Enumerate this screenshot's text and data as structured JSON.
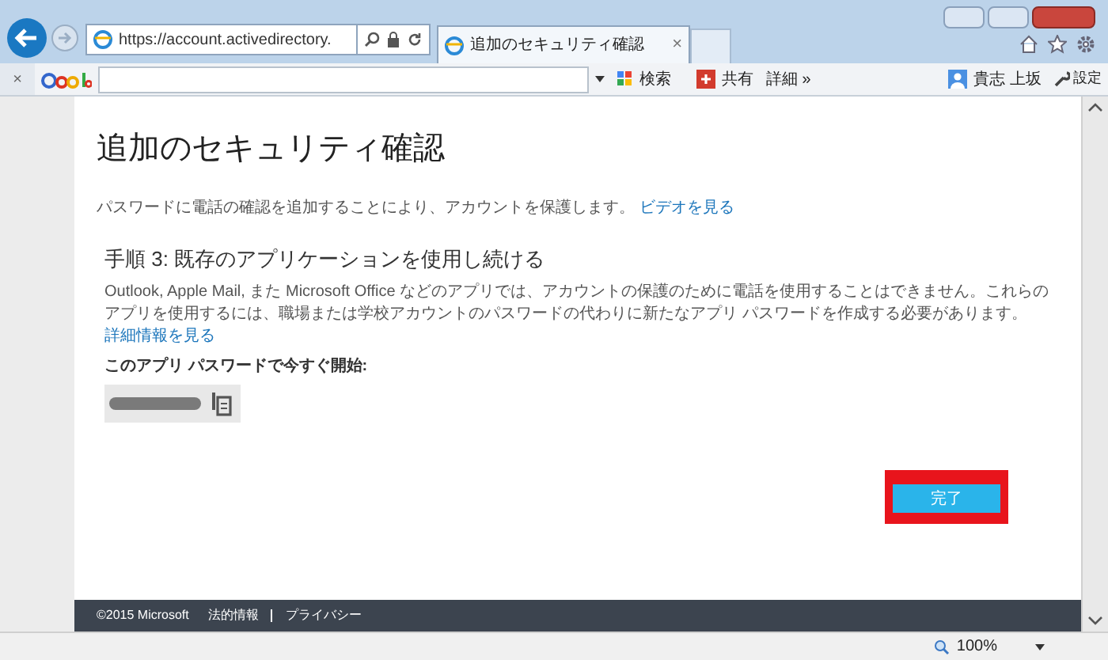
{
  "browser": {
    "address": "https://account.activedirectory.",
    "tab_title": "追加のセキュリティ確認",
    "toolbar": {
      "search_label": "検索",
      "share_label": "共有",
      "details_label": "詳細 »",
      "user_name": "貴志 上坂",
      "settings_label": "設定"
    },
    "close_mark": "×"
  },
  "page": {
    "title": "追加のセキュリティ確認",
    "intro": "パスワードに電話の確認を追加することにより、アカウントを保護します。",
    "intro_link": "ビデオを見る",
    "step_title": "手順 3: 既存のアプリケーションを使用し続ける",
    "step_text": "Outlook, Apple Mail, また Microsoft Office などのアプリでは、アカウントの保護のために電話を使用することはできません。これらのアプリを使用するには、職場または学校アカウントのパスワードの代わりに新たなアプリ パスワードを作成する必要があります。",
    "step_link": "詳細情報を見る",
    "password_label": "このアプリ パスワードで今すぐ開始:",
    "done_button": "完了",
    "done_highlighted": true
  },
  "footer": {
    "copyright": "©2015 Microsoft",
    "links": [
      "法的情報",
      "プライバシー"
    ]
  },
  "status_bar": {
    "zoom": "100%"
  }
}
